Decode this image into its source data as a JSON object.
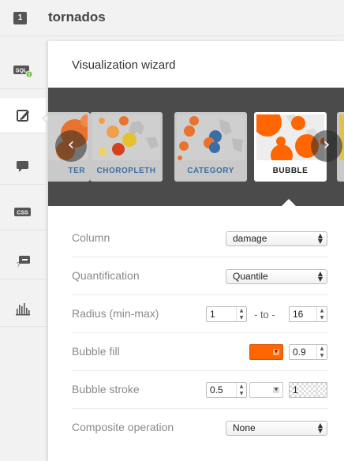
{
  "header": {
    "layer_number": "1",
    "layer_name": "tornados"
  },
  "rail": {
    "items": [
      {
        "icon": "sql-icon"
      },
      {
        "icon": "paint-brush-icon"
      },
      {
        "icon": "comment-icon"
      },
      {
        "icon": "css-icon"
      },
      {
        "icon": "legend-icon"
      },
      {
        "icon": "bar-chart-icon"
      }
    ]
  },
  "panel": {
    "title": "Visualization wizard"
  },
  "carousel": {
    "cards": [
      {
        "label": "TER"
      },
      {
        "label": "CHOROPLETH"
      },
      {
        "label": "CATEGORY"
      },
      {
        "label": "BUBBLE"
      }
    ],
    "selected": "BUBBLE"
  },
  "form": {
    "column": {
      "label": "Column",
      "value": "damage"
    },
    "quantification": {
      "label": "Quantification",
      "value": "Quantile"
    },
    "radius": {
      "label": "Radius (min-max)",
      "min": "1",
      "to_text": "- to -",
      "max": "16"
    },
    "bubble_fill": {
      "label": "Bubble fill",
      "color": "#ff6600",
      "opacity": "0.9"
    },
    "bubble_stroke": {
      "label": "Bubble stroke",
      "width": "0.5",
      "color": "#ffffff",
      "opacity": "1"
    },
    "composite": {
      "label": "Composite operation",
      "value": "None"
    }
  },
  "colors": {
    "accent_orange": "#ff6600",
    "carousel_bg": "#4b4b4b",
    "link_blue": "#3c6ea6"
  }
}
